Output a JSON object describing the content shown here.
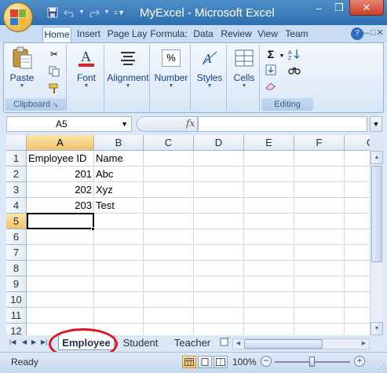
{
  "window": {
    "title": "MyExcel - Microsoft Excel",
    "minimize": "–",
    "restore": "❒",
    "close": "✕"
  },
  "quick_access": {
    "save_icon": "save-icon",
    "undo_icon": "undo-icon",
    "redo_icon": "redo-icon",
    "customize_icon": "chevron-down-icon"
  },
  "ribbon": {
    "tabs": [
      {
        "label": "Home",
        "active": true
      },
      {
        "label": "Insert",
        "active": false
      },
      {
        "label": "Page Lay",
        "active": false
      },
      {
        "label": "Formula:",
        "active": false
      },
      {
        "label": "Data",
        "active": false
      },
      {
        "label": "Review",
        "active": false
      },
      {
        "label": "View",
        "active": false
      },
      {
        "label": "Team",
        "active": false
      }
    ],
    "help_label": "?",
    "groups": {
      "clipboard": {
        "label": "Clipboard",
        "paste": "Paste"
      },
      "font": {
        "label": "Font"
      },
      "alignment": {
        "label": "Alignment"
      },
      "number": {
        "label": "Number",
        "icon_text": "%"
      },
      "styles": {
        "label": "Styles"
      },
      "cells": {
        "label": "Cells"
      },
      "editing": {
        "label": "Editing",
        "sum_icon": "Σ"
      }
    }
  },
  "formula_bar": {
    "name_box": "A5",
    "fx_label": "fx",
    "formula_value": ""
  },
  "grid": {
    "columns": [
      "A",
      "B",
      "C",
      "D",
      "E",
      "F",
      "G"
    ],
    "rows": [
      "1",
      "2",
      "3",
      "4",
      "5",
      "6",
      "7",
      "8",
      "9",
      "10",
      "11",
      "12"
    ],
    "selected_column": "A",
    "selected_row": "5",
    "cells": {
      "A1": "Employee ID",
      "B1": "Name",
      "A2": "201",
      "B2": "Abc",
      "A3": "202",
      "B3": "Xyz",
      "A4": "203",
      "B4": "Test"
    }
  },
  "sheet_tabs": [
    {
      "label": "Employee",
      "active": true
    },
    {
      "label": "Student",
      "active": false
    },
    {
      "label": "Teacher",
      "active": false
    }
  ],
  "status_bar": {
    "status": "Ready",
    "zoom": "100%",
    "zoom_level": 0.5
  },
  "colors": {
    "accent": "#4f8fc8",
    "highlight": "#e0161e"
  }
}
